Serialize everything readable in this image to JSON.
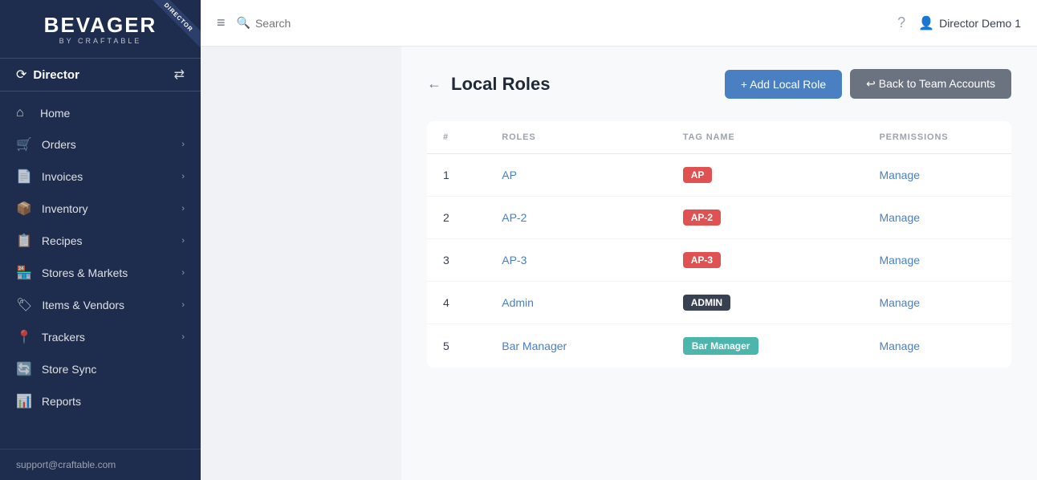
{
  "sidebar": {
    "logo": "BEVAGER",
    "logo_sub": "BY CRAFTABLE",
    "ribbon_text": "DIRECTOR",
    "director_label": "Director",
    "switch_icon": "⇄",
    "nav_items": [
      {
        "id": "home",
        "label": "Home",
        "icon": "⌂",
        "has_chevron": false
      },
      {
        "id": "orders",
        "label": "Orders",
        "icon": "🛒",
        "has_chevron": true
      },
      {
        "id": "invoices",
        "label": "Invoices",
        "icon": "📄",
        "has_chevron": true
      },
      {
        "id": "inventory",
        "label": "Inventory",
        "icon": "📦",
        "has_chevron": true
      },
      {
        "id": "recipes",
        "label": "Recipes",
        "icon": "📋",
        "has_chevron": true
      },
      {
        "id": "stores",
        "label": "Stores & Markets",
        "icon": "🏪",
        "has_chevron": true
      },
      {
        "id": "items",
        "label": "Items & Vendors",
        "icon": "🏷",
        "has_chevron": true
      },
      {
        "id": "trackers",
        "label": "Trackers",
        "icon": "📍",
        "has_chevron": true
      },
      {
        "id": "store-sync",
        "label": "Store Sync",
        "icon": "🔄",
        "has_chevron": false
      },
      {
        "id": "reports",
        "label": "Reports",
        "icon": "📊",
        "has_chevron": false
      }
    ],
    "footer_text": "support@craftable.com"
  },
  "topbar": {
    "search_placeholder": "Search",
    "user_name": "Director Demo 1"
  },
  "page": {
    "title": "Local Roles",
    "back_arrow": "←",
    "btn_add_label": "+ Add Local Role",
    "btn_back_label": "↩ Back to Team Accounts"
  },
  "table": {
    "columns": [
      "#",
      "ROLES",
      "TAG NAME",
      "PERMISSIONS"
    ],
    "rows": [
      {
        "num": "1",
        "role": "AP",
        "tag": "AP",
        "tag_color": "red",
        "permission": "Manage"
      },
      {
        "num": "2",
        "role": "AP-2",
        "tag": "AP-2",
        "tag_color": "red",
        "permission": "Manage"
      },
      {
        "num": "3",
        "role": "AP-3",
        "tag": "AP-3",
        "tag_color": "red",
        "permission": "Manage"
      },
      {
        "num": "4",
        "role": "Admin",
        "tag": "ADMIN",
        "tag_color": "dark",
        "permission": "Manage"
      },
      {
        "num": "5",
        "role": "Bar Manager",
        "tag": "Bar Manager",
        "tag_color": "teal",
        "permission": "Manage"
      }
    ]
  }
}
